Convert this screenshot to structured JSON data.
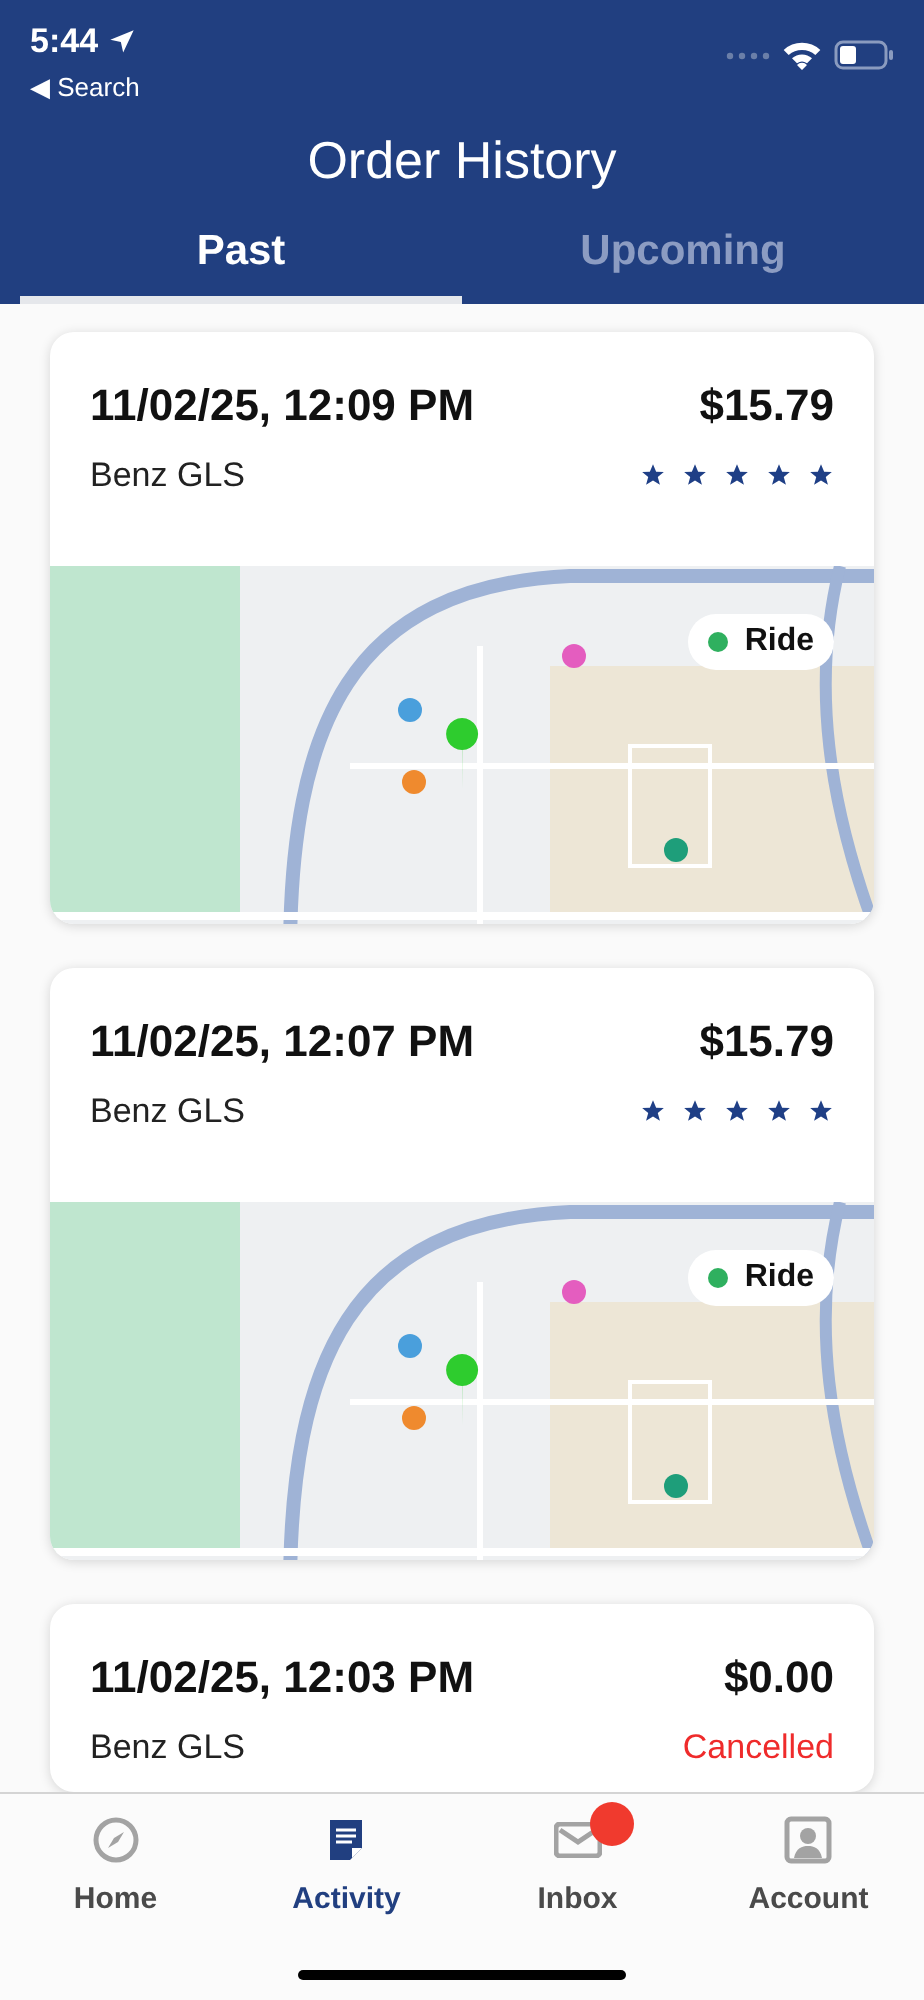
{
  "status_bar": {
    "time": "5:44",
    "back_label": "◀ Search"
  },
  "header": {
    "title": "Order History"
  },
  "tabs": [
    {
      "label": "Past",
      "selected": true
    },
    {
      "label": "Upcoming",
      "selected": false
    }
  ],
  "orders": [
    {
      "kind": "ride",
      "datetime": "11/02/25, 12:09 PM",
      "vehicle": "Benz GLS",
      "price": "$15.79",
      "stars": 5,
      "badge": "Ride"
    },
    {
      "kind": "ride",
      "datetime": "11/02/25, 12:07 PM",
      "vehicle": "Benz GLS",
      "price": "$15.79",
      "stars": 5,
      "badge": "Ride"
    },
    {
      "kind": "cancelled",
      "datetime": "11/02/25, 12:03 PM",
      "vehicle": "Benz GLS",
      "price": "$0.00",
      "status": "Cancelled"
    }
  ],
  "bottom_nav": [
    {
      "kind": "home",
      "label": "Home",
      "selected": false,
      "badge": false
    },
    {
      "kind": "activity",
      "label": "Activity",
      "selected": true,
      "badge": false
    },
    {
      "kind": "inbox",
      "label": "Inbox",
      "selected": false,
      "badge": true
    },
    {
      "kind": "account",
      "label": "Account",
      "selected": false,
      "badge": false
    }
  ]
}
